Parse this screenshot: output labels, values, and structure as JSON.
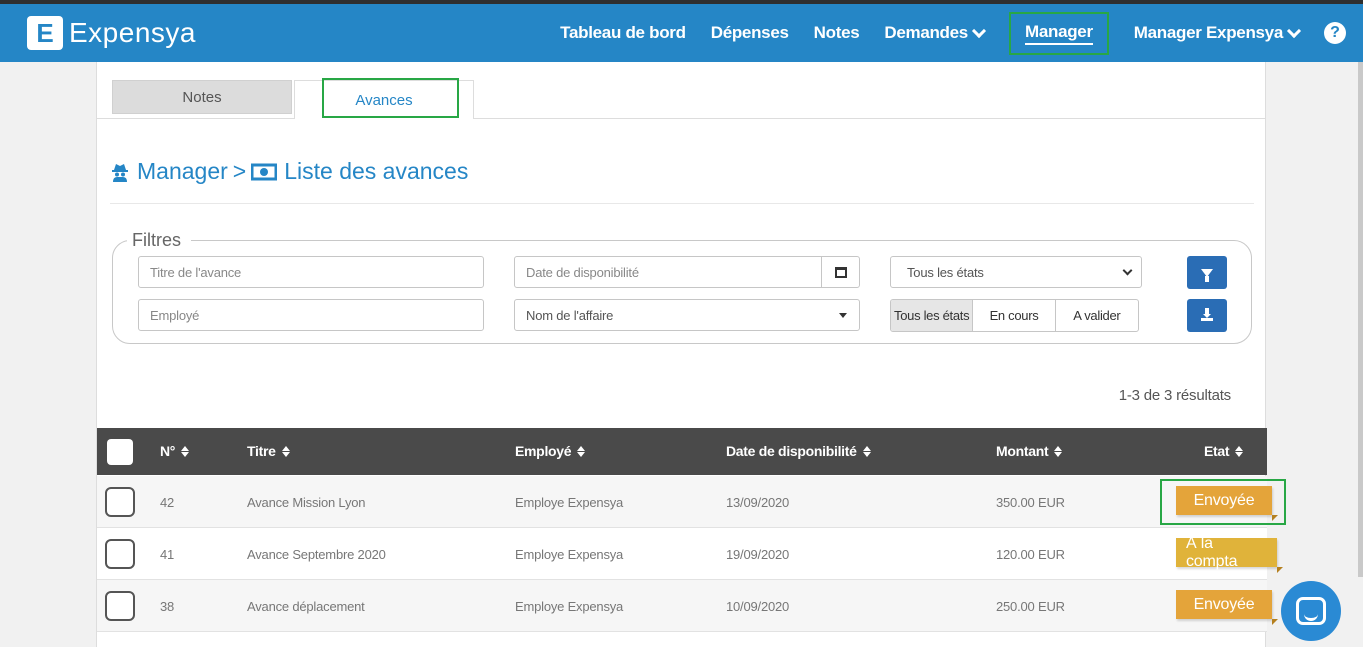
{
  "brand": {
    "logo_letter": "E",
    "name": "Expensya"
  },
  "nav": {
    "items": [
      {
        "label": "Tableau de bord",
        "dropdown": false,
        "active": false
      },
      {
        "label": "Dépenses",
        "dropdown": false,
        "active": false
      },
      {
        "label": "Notes",
        "dropdown": false,
        "active": false
      },
      {
        "label": "Demandes",
        "dropdown": true,
        "active": false
      },
      {
        "label": "Manager",
        "dropdown": false,
        "active": true
      },
      {
        "label": "Manager Expensya",
        "dropdown": true,
        "active": false
      }
    ],
    "help_label": "?"
  },
  "tabs": [
    {
      "label": "Notes",
      "active": false
    },
    {
      "label": "Avances",
      "active": true
    }
  ],
  "breadcrumb": {
    "part1": "Manager",
    "separator": ">",
    "part2": "Liste des avances"
  },
  "filters": {
    "legend": "Filtres",
    "title_placeholder": "Titre de l'avance",
    "date_placeholder": "Date de disponibilité",
    "state_select": "Tous les états",
    "employee_placeholder": "Employé",
    "affaire_placeholder": "Nom de l'affaire",
    "segments": [
      "Tous les états",
      "En cours",
      "A valider"
    ],
    "segment_active": 0
  },
  "results": "1-3 de 3 résultats",
  "table": {
    "headers": {
      "num": "N°",
      "title": "Titre",
      "employee": "Employé",
      "date": "Date de disponibilité",
      "amount": "Montant",
      "state": "Etat"
    },
    "rows": [
      {
        "num": "42",
        "title": "Avance Mission Lyon",
        "employee": "Employe Expensya",
        "date": "13/09/2020",
        "amount": "350.00 EUR",
        "state": "Envoyée"
      },
      {
        "num": "41",
        "title": "Avance Septembre 2020",
        "employee": "Employe Expensya",
        "date": "19/09/2020",
        "amount": "120.00 EUR",
        "state": "À la compta"
      },
      {
        "num": "38",
        "title": "Avance déplacement",
        "employee": "Employe Expensya",
        "date": "10/09/2020",
        "amount": "250.00 EUR",
        "state": "Envoyée"
      }
    ]
  },
  "colors": {
    "primary": "#2586c6",
    "highlight": "#28a745",
    "badge_sent": "#e4a43a",
    "badge_compta": "#e0b33a",
    "header_dark": "#4a4a4a"
  },
  "icons": {
    "manager": "spy-icon",
    "advances": "money-bill-icon",
    "filter_reset": "filter-reset-icon",
    "export": "download-icon",
    "calendar": "calendar-icon",
    "chat": "chat-icon"
  }
}
